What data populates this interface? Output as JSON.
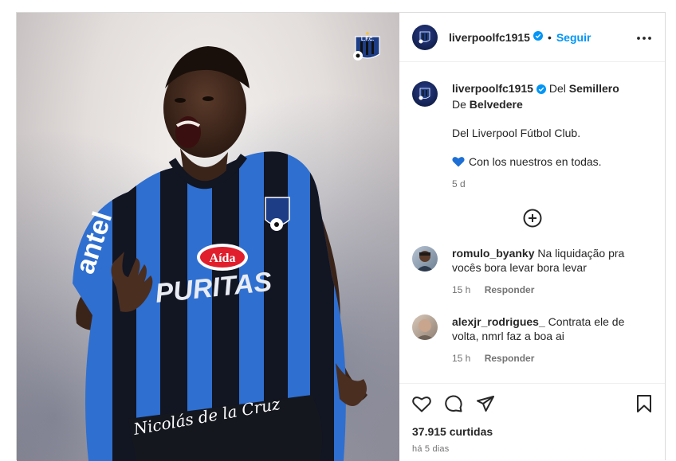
{
  "post": {
    "username": "liverpoolfc1915",
    "follow_label": "Seguir",
    "dot": "•",
    "image": {
      "player_signature": "Nicolás de la Cruz",
      "sponsor_main": "PURITAS",
      "sponsor_top": "Aída",
      "sleeve_sponsor": "antel",
      "club_badge": "L.F.C."
    },
    "caption": {
      "username": "liverpoolfc1915",
      "line1_a": " Del ",
      "line1_b": "Semillero",
      "line2_a": "De ",
      "line2_b": "Belvedere",
      "para2": "Del Liverpool Fútbol Club.",
      "para3": "Con los nuestros en todas.",
      "time": "5 d"
    },
    "comments": [
      {
        "username": "romulo_byanky",
        "text": " Na liquidação pra vocês bora levar bora levar",
        "time": "15 h",
        "reply": "Responder"
      },
      {
        "username": "alexjr_rodrigues_",
        "text": " Contrata ele de volta, nmrl faz a boa ai",
        "time": "15 h",
        "reply": "Responder"
      }
    ],
    "likes": "37.915 curtidas",
    "posted_ago": "há 5 dias"
  },
  "colors": {
    "accent": "#0095f6",
    "verified": "#0095f6",
    "heart": "#1d6fd6",
    "jersey_blue": "#2f6fd0",
    "jersey_black": "#121522"
  },
  "icons": [
    "verified-badge-icon",
    "more-options-icon",
    "add-comment-icon",
    "blue-heart-emoji-icon",
    "like-heart-icon",
    "comment-icon",
    "share-icon",
    "save-bookmark-icon"
  ]
}
